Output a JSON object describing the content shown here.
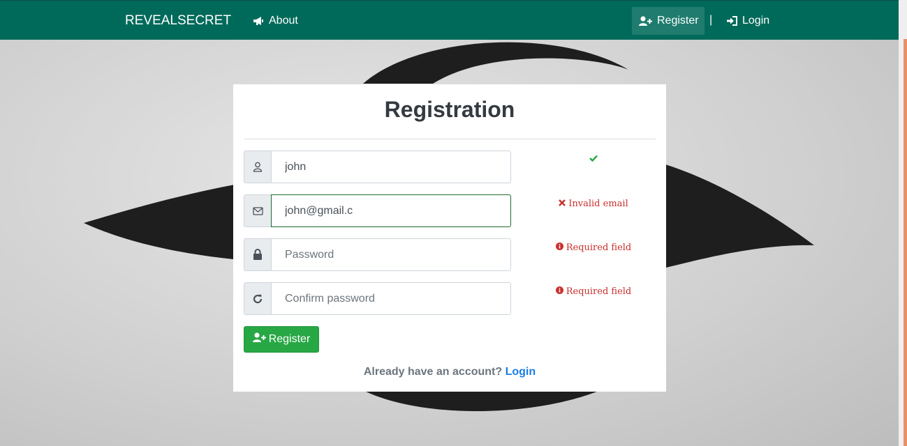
{
  "navbar": {
    "brand": "REVEALSECRET",
    "about_label": "About",
    "register_label": "Register",
    "separator": "|",
    "login_label": "Login"
  },
  "form": {
    "title": "Registration",
    "username": {
      "value": "john",
      "placeholder": ""
    },
    "email": {
      "value": "john@gmail.c",
      "placeholder": ""
    },
    "password": {
      "value": "",
      "placeholder": "Password"
    },
    "confirm": {
      "value": "",
      "placeholder": "Confirm password"
    },
    "feedback": {
      "email": "Invalid email",
      "password": "Required field",
      "confirm": "Required field"
    },
    "register_button": "Register",
    "footer_text": "Already have an account?",
    "footer_link": "Login"
  },
  "colors": {
    "navbar": "#006a5a",
    "success": "#28a745",
    "error": "#c9302c",
    "link": "#1a7ee6"
  }
}
